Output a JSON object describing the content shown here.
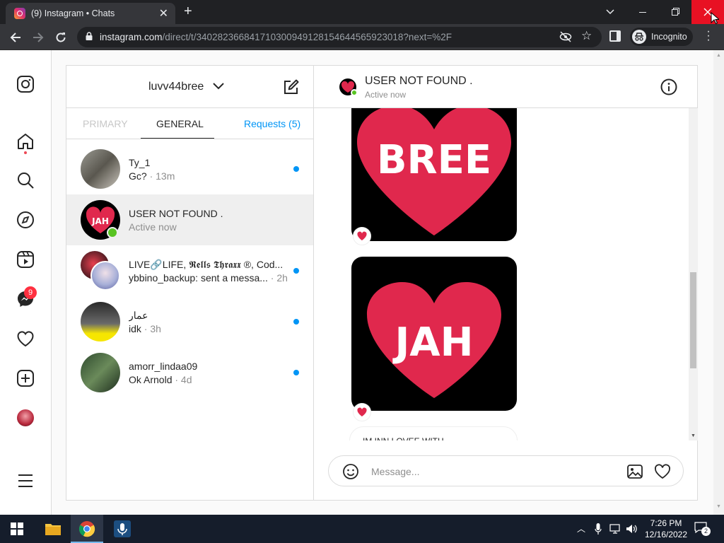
{
  "browser": {
    "tab_title": "(9) Instagram • Chats",
    "url_host": "instagram.com",
    "url_path": "/direct/t/340282366841710300949128154644565923018?next=%2F",
    "incognito_label": "Incognito"
  },
  "sidebar": {
    "messages_badge": "9"
  },
  "inbox": {
    "username": "luvv44bree",
    "tabs": {
      "primary": "PRIMARY",
      "general": "GENERAL",
      "requests": "Requests (5)"
    },
    "threads": [
      {
        "name": "Ty_1",
        "preview": "Gc?",
        "time": " · 13m",
        "unread": true
      },
      {
        "name": "USER NOT FOUND .",
        "preview": "Active now",
        "time": "",
        "unread": false
      },
      {
        "name": "LIVE🔗LIFE, 𝕽𝖊𝖑𝖑𝖘 𝕿𝖍𝖗𝖆𝖝𝖝 ®, Cod...",
        "preview": "ybbino_backup: sent a messa...",
        "time": " · 2h",
        "unread": true
      },
      {
        "name": "عمار",
        "preview": "idk",
        "time": " · 3h",
        "unread": true
      },
      {
        "name": "amorr_lindaa09",
        "preview": "Ok Arnold",
        "time": " · 4d",
        "unread": true
      }
    ]
  },
  "chat": {
    "title": "USER NOT FOUND .",
    "status": "Active now",
    "image1_text": "BREE",
    "image2_text": "JAH",
    "partial_message": "IM INN LOVEE WITH",
    "composer_placeholder": "Message..."
  },
  "taskbar": {
    "time": "7:26 PM",
    "date": "12/16/2022",
    "notifications": "2"
  },
  "colors": {
    "accent": "#0095f6",
    "heart": "#e0284d",
    "close": "#e81123"
  }
}
